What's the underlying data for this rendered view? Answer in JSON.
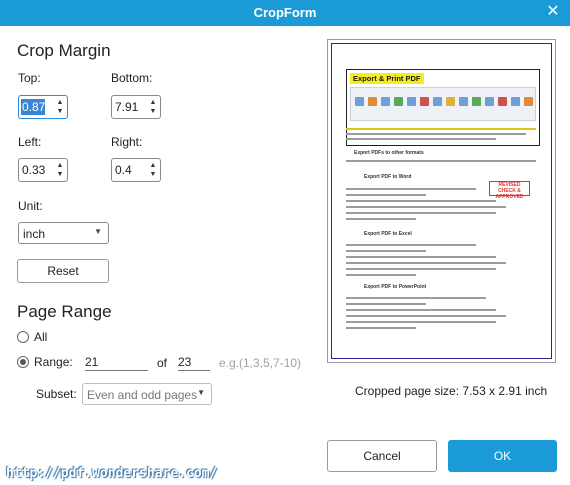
{
  "window": {
    "title": "CropForm",
    "close_glyph": "✕"
  },
  "crop_margin": {
    "heading": "Crop Margin",
    "top": {
      "label": "Top:",
      "value": "0.87"
    },
    "bottom": {
      "label": "Bottom:",
      "value": "7.91"
    },
    "left": {
      "label": "Left:",
      "value": "0.33"
    },
    "right": {
      "label": "Right:",
      "value": "0.4"
    },
    "unit": {
      "label": "Unit:",
      "value": "inch"
    },
    "reset_label": "Reset"
  },
  "page_range": {
    "heading": "Page Range",
    "all_label": "All",
    "range_label": "Range:",
    "range_from": "21",
    "of_label": "of",
    "range_to": "23",
    "hint": "e.g.(1,3,5,7-10)",
    "subset_label": "Subset:",
    "subset_value": "Even and odd pages",
    "selected": "range"
  },
  "preview": {
    "header_tag": "Export & Print PDF",
    "section_1": "Export PDFs to other formats",
    "section_2": "Export PDF to Word",
    "section_3": "Export PDF to Excel",
    "section_4": "Export PDF to PowerPoint",
    "stamp_line_1": "REVISED",
    "stamp_line_2": "CHECK & APPROVED"
  },
  "cropped_size": "Cropped page size: 7.53 x 2.91 inch",
  "buttons": {
    "cancel": "Cancel",
    "ok": "OK"
  },
  "watermark": "http://pdf.wondershare.com/",
  "colors": {
    "accent": "#1a9ad6"
  }
}
